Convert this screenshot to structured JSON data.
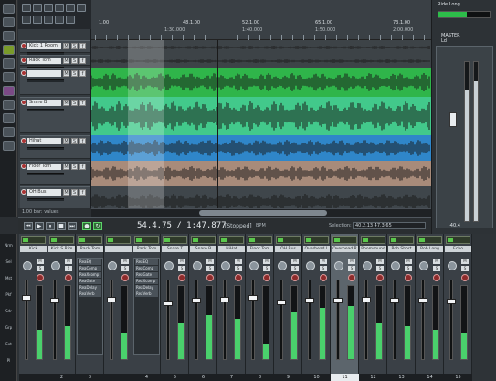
{
  "ruler": {
    "bars": [
      "1.00",
      "48.1.00",
      "52.1.00",
      "65.1.00",
      "73.1.00"
    ],
    "times": [
      "1:30.000",
      "1:40.000",
      "1:50.000",
      "2:00.000"
    ]
  },
  "tracks": [
    {
      "name": "Kick 1 Room",
      "color": "#3d4347"
    },
    {
      "name": "Rack Tom",
      "color": "#3d4347"
    },
    {
      "name": "",
      "color": "#2fb54a"
    },
    {
      "name": "Snare B",
      "color": "#42c98b"
    },
    {
      "name": "Hihat",
      "color": "#2f86c9"
    },
    {
      "name": "Floor Tom",
      "color": "#a88b7a"
    },
    {
      "name": "OH Bus",
      "color": "#3f464b"
    }
  ],
  "statusbar": {
    "text": "1.00 bar: values"
  },
  "right_panel": {
    "title": "Ride Long",
    "master_label": "MASTER",
    "master_sub": "Ld",
    "master_value": "-40.4",
    "meter_level": 0.55,
    "bar_levels": [
      0.82,
      0.88
    ]
  },
  "transport": {
    "position": "54.4.75 / 1:47.877",
    "state": "[Stopped]",
    "bpm_label": "BPM",
    "selection_label": "Selection:",
    "selection_value": "40.2.13  47.3.65"
  },
  "mixer_left_labels": [
    "Nrm",
    "Sel",
    "Mst",
    "Pkf",
    "Sdr",
    "Grp",
    "Ext",
    "Pl"
  ],
  "mixer": {
    "strips": [
      {
        "name": "Kick",
        "num": "",
        "fader": 0.18,
        "meter": 0.4,
        "fx": []
      },
      {
        "name": "Kick S Rim",
        "num": "2",
        "fader": 0.22,
        "meter": 0.45,
        "fx": []
      },
      {
        "name": "Rack Tom",
        "num": "3",
        "fader": 0.15,
        "meter": 0.3,
        "fx": [
          "ReaEQ",
          "ReaComp",
          "ReaXcomp",
          "ReaGate",
          "ReaDelay",
          "ReaVerb"
        ]
      },
      {
        "name": "",
        "num": "",
        "fader": 0.2,
        "meter": 0.35,
        "fx": []
      },
      {
        "name": "Rack Tom",
        "num": "4",
        "fader": 0.2,
        "meter": 0.28,
        "fx": [
          "ReaEQ",
          "ReaComp",
          "ReaGate",
          "ReaXcomp",
          "ReaDelay",
          "ReaVerb"
        ]
      },
      {
        "name": "Snare T",
        "num": "5",
        "fader": 0.25,
        "meter": 0.5,
        "fx": []
      },
      {
        "name": "Snare B",
        "num": "6",
        "fader": 0.22,
        "meter": 0.6,
        "fx": []
      },
      {
        "name": "HiHat",
        "num": "7",
        "fader": 0.2,
        "meter": 0.55,
        "fx": []
      },
      {
        "name": "Floor Tom",
        "num": "8",
        "fader": 0.18,
        "meter": 0.2,
        "fx": []
      },
      {
        "name": "OH Bus",
        "num": "9",
        "fader": 0.24,
        "meter": 0.65,
        "fx": []
      },
      {
        "name": "Overhead L",
        "num": "10",
        "fader": 0.22,
        "meter": 0.7,
        "fx": []
      },
      {
        "name": "Overhead R",
        "num": "11",
        "fader": 0.22,
        "meter": 0.72,
        "fx": []
      },
      {
        "name": "Roomsound",
        "num": "12",
        "fader": 0.2,
        "meter": 0.5,
        "fx": []
      },
      {
        "name": "Rob Short",
        "num": "13",
        "fader": 0.21,
        "meter": 0.45,
        "fx": []
      },
      {
        "name": "Rob Long",
        "num": "14",
        "fader": 0.21,
        "meter": 0.4,
        "fx": []
      },
      {
        "name": "Echo",
        "num": "15",
        "fader": 0.23,
        "meter": 0.35,
        "fx": []
      }
    ]
  }
}
